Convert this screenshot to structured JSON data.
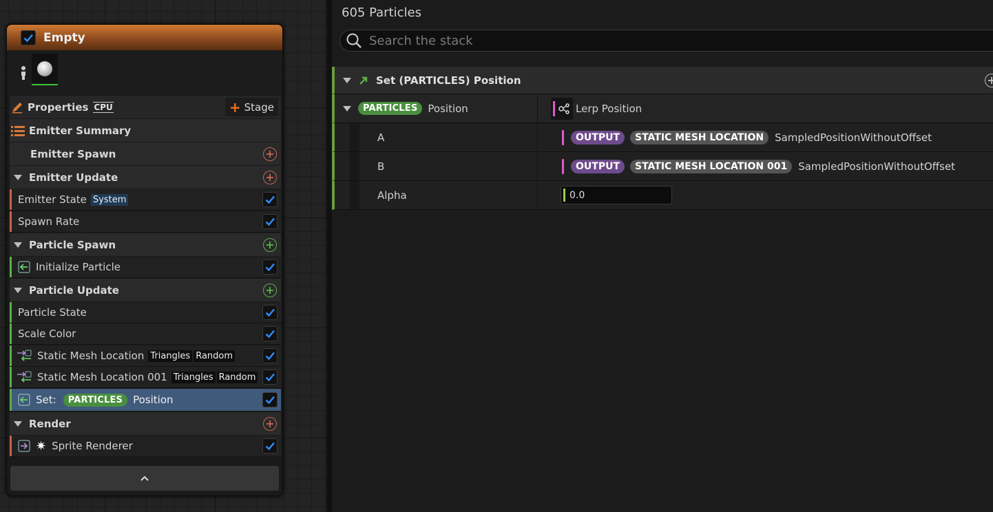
{
  "node": {
    "title": "Empty",
    "properties_label": "Properties",
    "cpu_label": "CPU",
    "stage_label": "Stage",
    "summary_label": "Emitter Summary",
    "sections": {
      "emitter_spawn": "Emitter Spawn",
      "emitter_update": "Emitter Update",
      "particle_spawn": "Particle Spawn",
      "particle_update": "Particle Update",
      "render": "Render"
    },
    "items": {
      "emitter_state": "Emitter State",
      "emitter_state_tag": "System",
      "spawn_rate": "Spawn Rate",
      "initialize_particle": "Initialize Particle",
      "particle_state": "Particle State",
      "scale_color": "Scale Color",
      "sml": "Static Mesh Location",
      "sml_001": "Static Mesh Location 001",
      "triangles": "Triangles",
      "random": "Random",
      "set_prefix": "Set:",
      "particles_pill": "PARTICLES",
      "position": "Position",
      "sprite_renderer": "Sprite Renderer"
    },
    "colors": {
      "accent_orange": "#d07a33",
      "update_green": "#5cae4a",
      "spawn_red": "#c9624f",
      "check_blue": "#2f8fff"
    }
  },
  "panel": {
    "count": "605 Particles",
    "search_placeholder": "Search the stack",
    "module_title": "Set (PARTICLES) Position",
    "param_pill": "PARTICLES",
    "param_name": "Position",
    "param_value": "Lerp Position",
    "rows": [
      {
        "label": "A",
        "output": "OUTPUT",
        "source": "STATIC MESH LOCATION",
        "attr": "SampledPositionWithoutOffset"
      },
      {
        "label": "B",
        "output": "OUTPUT",
        "source": "STATIC MESH LOCATION 001",
        "attr": "SampledPositionWithoutOffset"
      }
    ],
    "alpha_label": "Alpha",
    "alpha_value": "0.0"
  }
}
